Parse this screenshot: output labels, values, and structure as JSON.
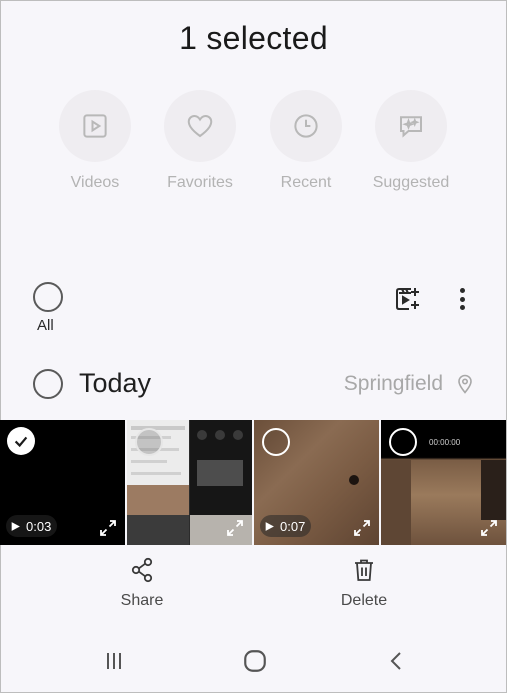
{
  "header": {
    "title": "1 selected"
  },
  "shortcuts": [
    {
      "label": "Videos",
      "icon": "video-play-icon"
    },
    {
      "label": "Favorites",
      "icon": "heart-icon"
    },
    {
      "label": "Recent",
      "icon": "clock-icon"
    },
    {
      "label": "Suggested",
      "icon": "sparkle-chat-icon"
    }
  ],
  "select_all": {
    "label": "All",
    "checked": false
  },
  "toolbar": {
    "create_icon": "create-video-icon",
    "more_icon": "more-vertical-icon"
  },
  "group": {
    "label": "Today",
    "location": "Springfield",
    "checked": false
  },
  "items": [
    {
      "type": "video",
      "duration": "0:03",
      "selected": true
    },
    {
      "type": "image",
      "selected": false
    },
    {
      "type": "video",
      "duration": "0:07",
      "selected": false
    },
    {
      "type": "image",
      "selected": false,
      "overlay_text": "00:00:00"
    }
  ],
  "actions": {
    "share_label": "Share",
    "delete_label": "Delete"
  },
  "colors": {
    "background": "#f7f6fa",
    "shortcut_label": "#b3b3b3",
    "location": "#a8a8a8"
  }
}
